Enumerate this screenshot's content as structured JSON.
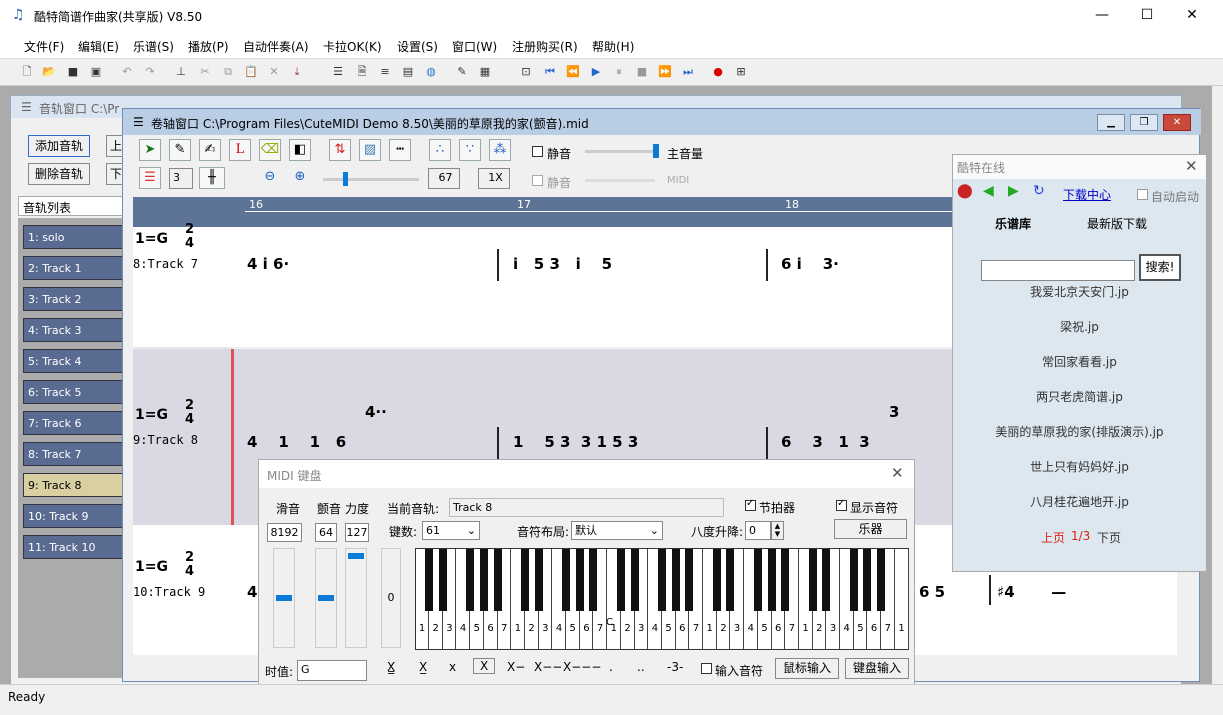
{
  "app": {
    "title": "酷特简谱作曲家(共享版) V8.50"
  },
  "menu": [
    "文件(F)",
    "编辑(E)",
    "乐谱(S)",
    "播放(P)",
    "自动伴奏(A)",
    "卡拉OK(K)",
    "设置(S)",
    "窗口(W)",
    "注册购买(R)",
    "帮助(H)"
  ],
  "track_window": {
    "caption": "音轨窗口  C:\\Pr",
    "add": "添加音轨",
    "del": "删除音轨",
    "up": "上",
    "down": "下",
    "list_header": "音轨列表",
    "tracks": [
      "1: solo",
      "2: Track 1",
      "3: Track 2",
      "4: Track 3",
      "5: Track 4",
      "6: Track 5",
      "7: Track 6",
      "8: Track 7",
      "9: Track 8",
      "10: Track 9",
      "11: Track 10"
    ]
  },
  "roll": {
    "caption": "卷轴窗口  C:\\Program Files\\CuteMIDI Demo 8.50\\美丽的草原我的家(颤音).mid",
    "mute": "静音",
    "mute2": "静音",
    "volume": "主音量",
    "midi": "MIDI",
    "num3": "3",
    "zoom": "67",
    "speed": "1X",
    "measures": [
      "16",
      "17",
      "18"
    ],
    "staves": [
      {
        "key": "1=G",
        "track": "8:Track 7"
      },
      {
        "key": "1=G",
        "track": "9:Track 8"
      },
      {
        "key": "1=G",
        "track": "10:Track 9"
      }
    ]
  },
  "online": {
    "title": "酷特在线",
    "download": "下载中心",
    "autostart": "自动启动",
    "tab1": "乐谱库",
    "tab2": "最新版下载",
    "search": "搜索!",
    "songs": [
      "我爱北京天安门.jp",
      "梁祝.jp",
      "常回家看看.jp",
      "两只老虎简谱.jp",
      "美丽的草原我的家(排版演示).jp",
      "世上只有妈妈好.jp",
      "八月桂花遍地开.jp"
    ],
    "prev": "上页",
    "page": "1/3",
    "next": "下页"
  },
  "midi": {
    "title": "MIDI 键盘",
    "slide": "滑音",
    "vibrato": "颤音",
    "velocity": "力度",
    "cur_track_label": "当前音轨:",
    "cur_track": "Track 8",
    "metronome": "节拍器",
    "show_notes": "显示音符",
    "slide_v": "8192",
    "vib_v": "64",
    "vel_v": "127",
    "zero": "0",
    "keys_label": "键数:",
    "keys_v": "61",
    "layout_label": "音符布局:",
    "layout_v": "默认",
    "octave_label": "八度升降:",
    "octave_v": "0",
    "instrument": "乐器",
    "duration_label": "时值:",
    "duration_v": "G",
    "input_note": "输入音符",
    "mouse_in": "鼠标输入",
    "kbd_in": "键盘输入",
    "middle_c": "C"
  },
  "status": "Ready"
}
